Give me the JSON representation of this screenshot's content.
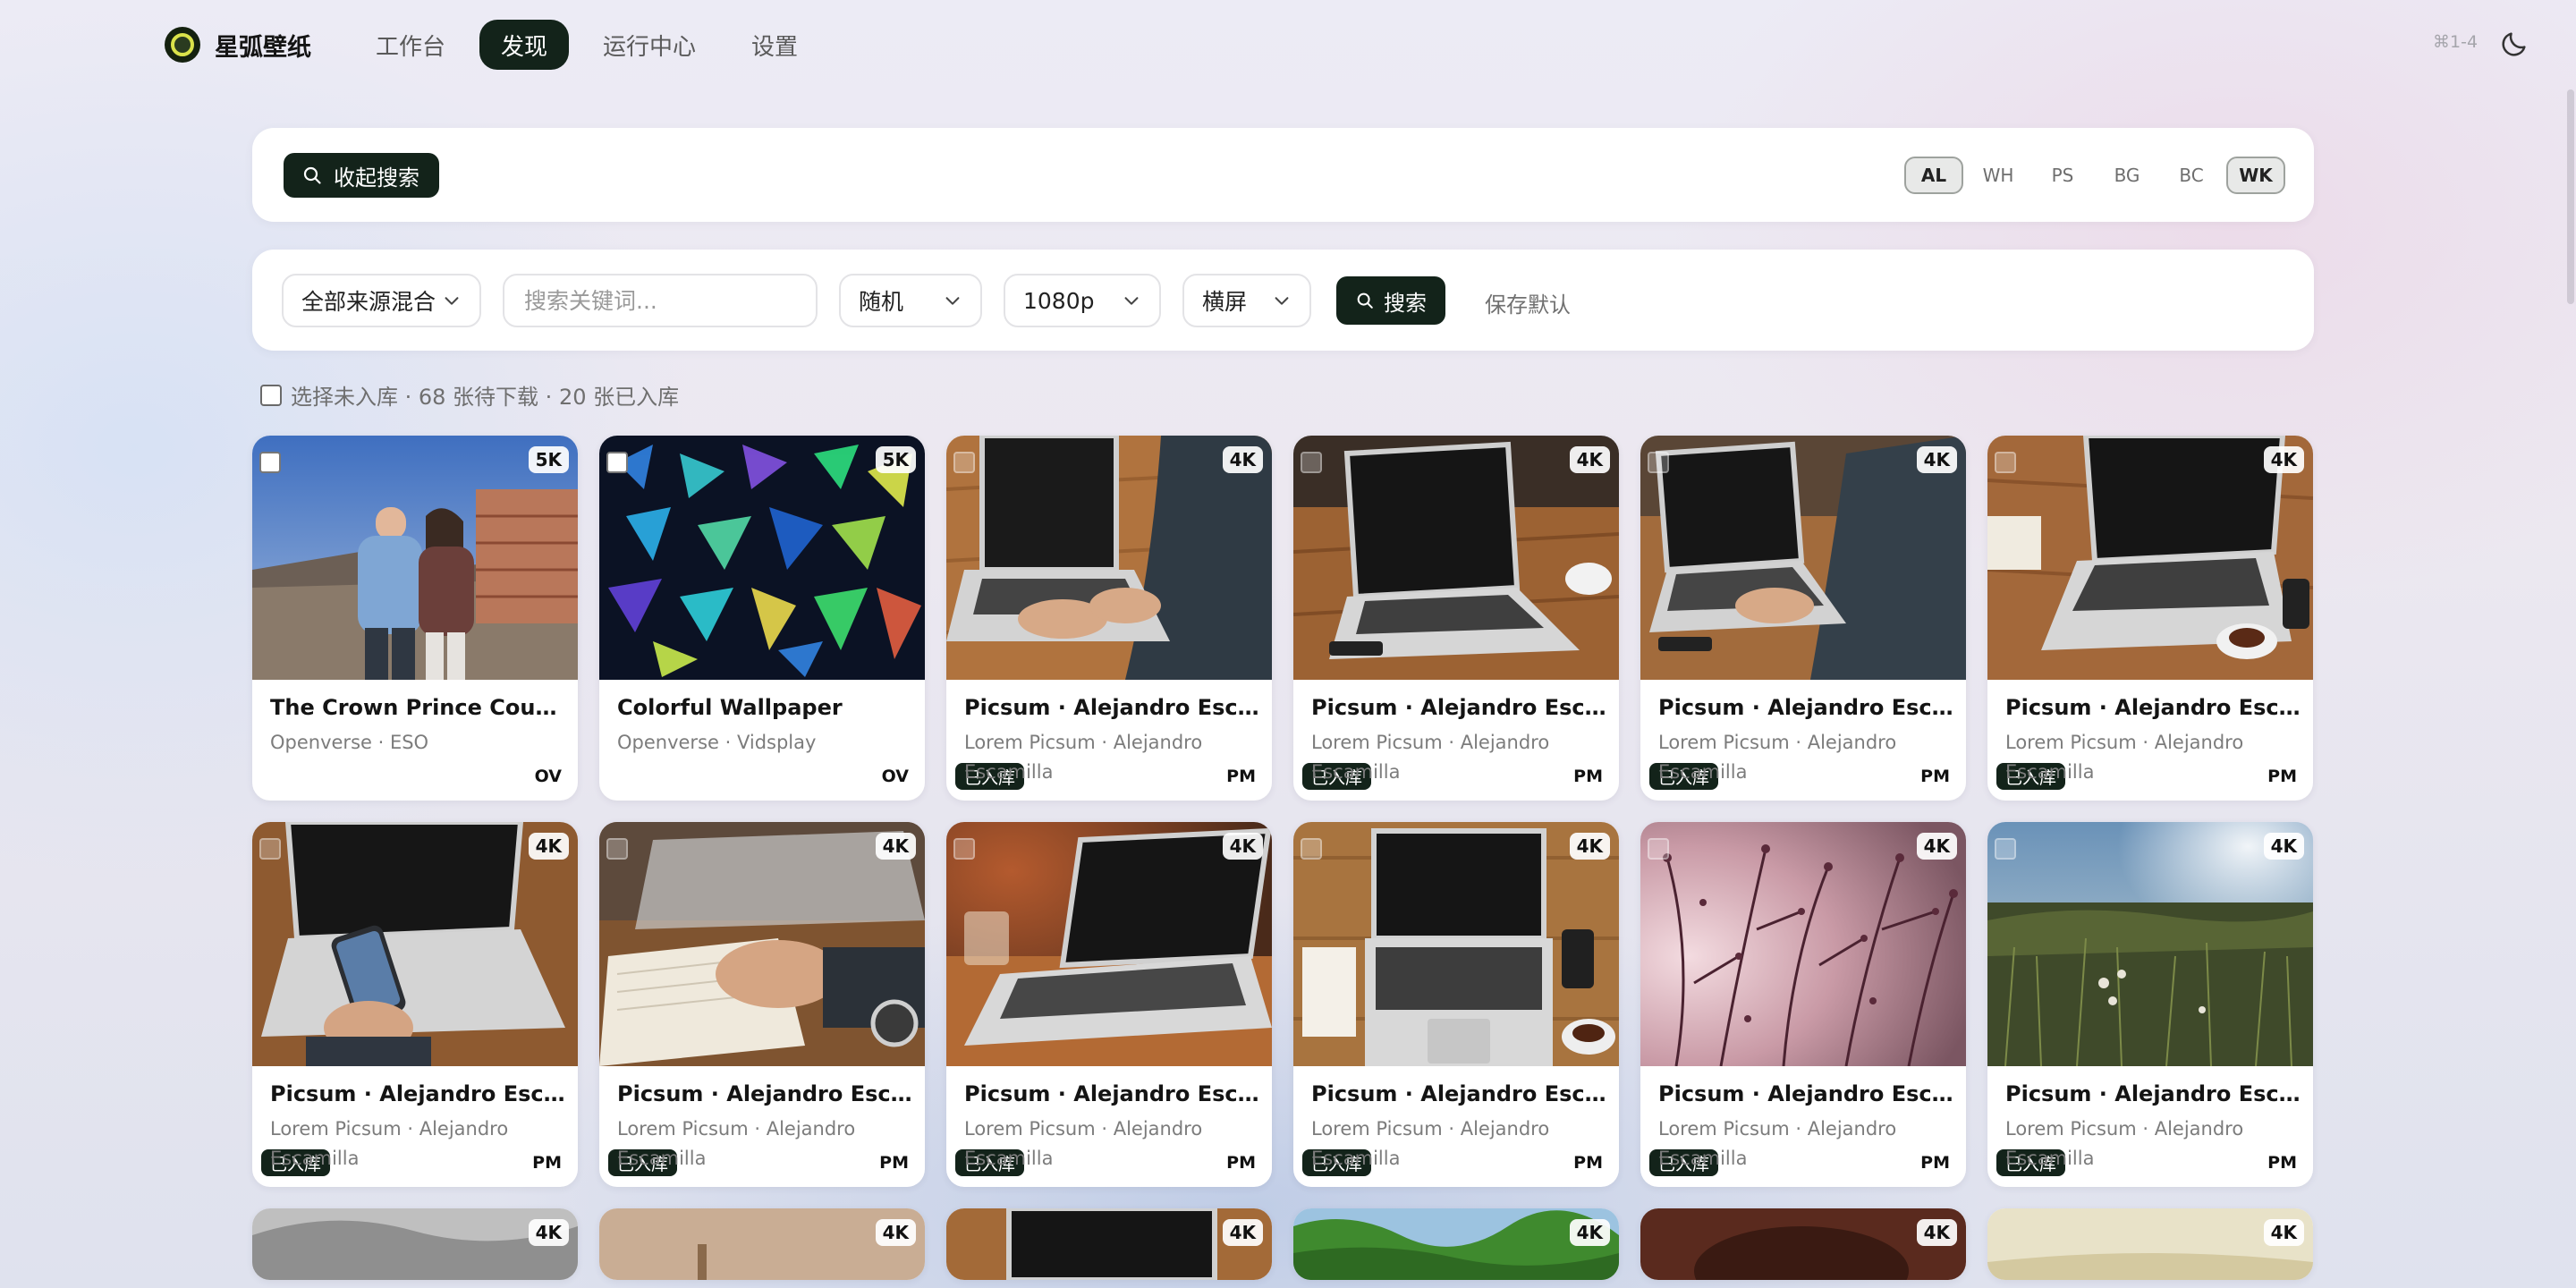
{
  "app": {
    "name": "星弧壁纸"
  },
  "nav": [
    {
      "label": "工作台",
      "active": false
    },
    {
      "label": "发现",
      "active": true
    },
    {
      "label": "运行中心",
      "active": false
    },
    {
      "label": "设置",
      "active": false
    }
  ],
  "header": {
    "shortcut": "⌘1-4"
  },
  "search_panel": {
    "collapse_label": "收起搜索",
    "sources": [
      {
        "label": "AL",
        "on": true
      },
      {
        "label": "WH",
        "on": false
      },
      {
        "label": "PS",
        "on": false
      },
      {
        "label": "BG",
        "on": false
      },
      {
        "label": "BC",
        "on": false
      },
      {
        "label": "WK",
        "on": true
      }
    ]
  },
  "filters": {
    "source_mode": "全部来源混合",
    "keyword_placeholder": "搜索关键词...",
    "sort": "随机",
    "resolution": "1080p",
    "orientation": "横屏",
    "search_label": "搜索",
    "save_default_label": "保存默认"
  },
  "status": {
    "text": "选择未入库 · 68 张待下载 · 20 张已入库"
  },
  "stored_badge": "已入库",
  "tiles": [
    {
      "title": "The Crown Prince Couple o...",
      "sub": "Openverse · ESO",
      "res": "5K",
      "lic": "OV",
      "stored": false
    },
    {
      "title": "Colorful Wallpaper",
      "sub": "Openverse · Vidsplay",
      "res": "5K",
      "lic": "OV",
      "stored": false
    },
    {
      "title": "Picsum · Alejandro Escamilla",
      "sub": "Lorem Picsum · Alejandro Escamilla",
      "res": "4K",
      "lic": "PM",
      "stored": true
    },
    {
      "title": "Picsum · Alejandro Escamilla",
      "sub": "Lorem Picsum · Alejandro Escamilla",
      "res": "4K",
      "lic": "PM",
      "stored": true
    },
    {
      "title": "Picsum · Alejandro Escamilla",
      "sub": "Lorem Picsum · Alejandro Escamilla",
      "res": "4K",
      "lic": "PM",
      "stored": true
    },
    {
      "title": "Picsum · Alejandro Escamilla",
      "sub": "Lorem Picsum · Alejandro Escamilla",
      "res": "4K",
      "lic": "PM",
      "stored": true
    },
    {
      "title": "Picsum · Alejandro Escamilla",
      "sub": "Lorem Picsum · Alejandro Escamilla",
      "res": "4K",
      "lic": "PM",
      "stored": true
    },
    {
      "title": "Picsum · Alejandro Escamilla",
      "sub": "Lorem Picsum · Alejandro Escamilla",
      "res": "4K",
      "lic": "PM",
      "stored": true
    },
    {
      "title": "Picsum · Alejandro Escamilla",
      "sub": "Lorem Picsum · Alejandro Escamilla",
      "res": "4K",
      "lic": "PM",
      "stored": true
    },
    {
      "title": "Picsum · Alejandro Escamilla",
      "sub": "Lorem Picsum · Alejandro Escamilla",
      "res": "4K",
      "lic": "PM",
      "stored": true
    },
    {
      "title": "Picsum · Alejandro Escamilla",
      "sub": "Lorem Picsum · Alejandro Escamilla",
      "res": "4K",
      "lic": "PM",
      "stored": true
    },
    {
      "title": "Picsum · Alejandro Escamilla",
      "sub": "Lorem Picsum · Alejandro Escamilla",
      "res": "4K",
      "lic": "PM",
      "stored": true
    }
  ],
  "partial_tiles": [
    {
      "res": "4K"
    },
    {
      "res": "4K"
    },
    {
      "res": "4K"
    },
    {
      "res": "4K"
    },
    {
      "res": "4K"
    },
    {
      "res": "4K"
    }
  ]
}
